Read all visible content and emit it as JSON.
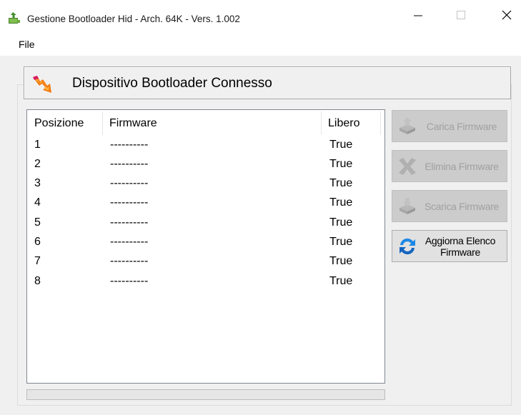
{
  "window": {
    "title": "Gestione Bootloader Hid - Arch. 64K - Vers. 1.002",
    "minimize_icon": "minimize-icon",
    "maximize_icon": "maximize-icon",
    "close_icon": "close-icon"
  },
  "menu": {
    "items": [
      {
        "label": "File"
      }
    ]
  },
  "header": {
    "title": "Dispositivo Bootloader Connesso",
    "icon": "lightning-arrow-icon"
  },
  "table": {
    "columns": [
      "Posizione",
      "Firmware",
      "Libero"
    ],
    "rows": [
      {
        "posizione": "1",
        "firmware": "----------",
        "libero": "True"
      },
      {
        "posizione": "2",
        "firmware": "----------",
        "libero": "True"
      },
      {
        "posizione": "3",
        "firmware": "----------",
        "libero": "True"
      },
      {
        "posizione": "4",
        "firmware": "----------",
        "libero": "True"
      },
      {
        "posizione": "5",
        "firmware": "----------",
        "libero": "True"
      },
      {
        "posizione": "6",
        "firmware": "----------",
        "libero": "True"
      },
      {
        "posizione": "7",
        "firmware": "----------",
        "libero": "True"
      },
      {
        "posizione": "8",
        "firmware": "----------",
        "libero": "True"
      }
    ]
  },
  "buttons": {
    "carica": {
      "label": "Carica Firmware",
      "icon": "upload-firmware-icon",
      "enabled": false
    },
    "elimina": {
      "label": "Elimina Firmware",
      "icon": "delete-x-icon",
      "enabled": false
    },
    "scarica": {
      "label": "Scarica Firmware",
      "icon": "download-firmware-icon",
      "enabled": false
    },
    "aggiorna": {
      "label": "Aggiorna Elenco Firmware",
      "icon": "refresh-icon",
      "enabled": true
    }
  },
  "progress": {
    "value": 0
  },
  "colors": {
    "window_bg": "#f0f0f0",
    "list_bg": "#ffffff",
    "button_disabled_bg": "#cccccc",
    "button_disabled_text": "#a0a0a0",
    "refresh_icon_blue": "#1e88e5"
  }
}
